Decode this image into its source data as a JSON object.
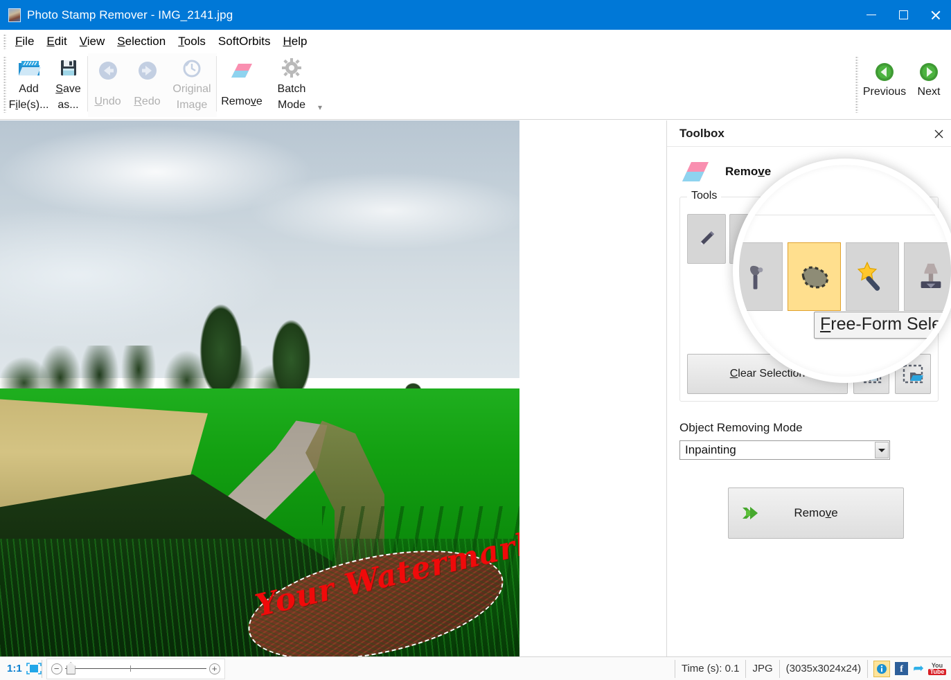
{
  "window": {
    "title": "Photo Stamp Remover - IMG_2141.jpg",
    "app_icon": "photo-thumbnail-icon",
    "controls": {
      "minimize": "minimize-icon",
      "maximize": "maximize-icon",
      "close": "close-icon"
    }
  },
  "menubar": {
    "items": [
      {
        "label": "File",
        "accel": "F"
      },
      {
        "label": "Edit",
        "accel": "E"
      },
      {
        "label": "View",
        "accel": "V"
      },
      {
        "label": "Selection",
        "accel": "S"
      },
      {
        "label": "Tools",
        "accel": "T"
      },
      {
        "label": "SoftOrbits",
        "accel": ""
      },
      {
        "label": "Help",
        "accel": "H"
      }
    ]
  },
  "ribbon": {
    "buttons": [
      {
        "name": "add-files",
        "line1": "Add",
        "line2": "File(s)...",
        "accel": "i",
        "icon": "open-folder-icon",
        "disabled": false
      },
      {
        "name": "save-as",
        "line1": "Save",
        "line2": "as...",
        "accel": "S",
        "icon": "floppy-disk-icon",
        "disabled": false
      },
      {
        "name": "undo",
        "line1": "",
        "line2": "Undo",
        "accel": "U",
        "icon": "undo-arrow-icon",
        "disabled": true
      },
      {
        "name": "redo",
        "line1": "",
        "line2": "Redo",
        "accel": "R",
        "icon": "redo-arrow-icon",
        "disabled": true
      },
      {
        "name": "original-image",
        "line1": "Original",
        "line2": "Image",
        "accel": "",
        "icon": "clock-revert-icon",
        "disabled": true
      },
      {
        "name": "remove",
        "line1": "",
        "line2": "Remove",
        "accel": "v",
        "icon": "eraser-icon",
        "disabled": false
      },
      {
        "name": "batch-mode",
        "line1": "Batch",
        "line2": "Mode",
        "accel": "",
        "icon": "gear-icon",
        "disabled": false
      }
    ],
    "expand_label": "▾",
    "nav": [
      {
        "name": "previous",
        "label": "Previous",
        "icon": "green-left-arrow-icon"
      },
      {
        "name": "next",
        "label": "Next",
        "icon": "green-right-arrow-icon"
      }
    ]
  },
  "canvas": {
    "watermark_text": "Your Watermark",
    "selection_active": true,
    "image_description": "rural landscape with dirt road, trees, green field"
  },
  "toolbox": {
    "title": "Toolbox",
    "close_icon": "close-icon",
    "remove_section": {
      "title": "Remove",
      "title_accel": "v",
      "icon": "eraser-icon"
    },
    "tools_group": {
      "legend": "Tools",
      "tools": [
        {
          "name": "marker-tool",
          "icon": "pencil-icon",
          "selected": false
        },
        {
          "name": "spot-remover-tool",
          "icon": "spot-remover-icon",
          "selected": false
        },
        {
          "name": "free-form-select-tool",
          "icon": "free-form-select-icon",
          "selected": true
        },
        {
          "name": "magic-wand-tool",
          "icon": "magic-wand-icon",
          "selected": false
        },
        {
          "name": "clone-stamp-tool",
          "icon": "clone-stamp-icon",
          "selected": false
        }
      ],
      "clear_selection_label": "Clear Selection",
      "clear_selection_accel": "C",
      "save_selection_icon": "save-selection-icon",
      "load_selection_icon": "load-selection-icon"
    },
    "mode": {
      "label": "Object Removing Mode",
      "value": "Inpainting",
      "arrow_icon": "chevron-down-icon"
    },
    "remove_button": {
      "label": "Remove",
      "accel": "v",
      "icon": "green-double-arrow-icon"
    }
  },
  "tooltip": {
    "text": "Free-Form Select",
    "accel": "F"
  },
  "statusbar": {
    "zoom_ratio": "1:1",
    "fit_icon": "fit-to-screen-icon",
    "zoom_out_icon": "minus-icon",
    "zoom_in_icon": "plus-icon",
    "time_label": "Time (s): 0.1",
    "format": "JPG",
    "dimensions": "(3035x3024x24)",
    "info_icon": "info-icon",
    "facebook_icon": "facebook-icon",
    "twitter_icon": "twitter-icon",
    "youtube_icon": "youtube-icon",
    "youtube_top": "You",
    "youtube_bottom": "Tube",
    "facebook_letter": "f"
  },
  "colors": {
    "titlebar": "#0078d7",
    "selected_tool": "#ffdf8e",
    "accent_green": "#3ba536",
    "watermark_red": "#f00a0a",
    "info_highlight": "#ffe49a"
  }
}
